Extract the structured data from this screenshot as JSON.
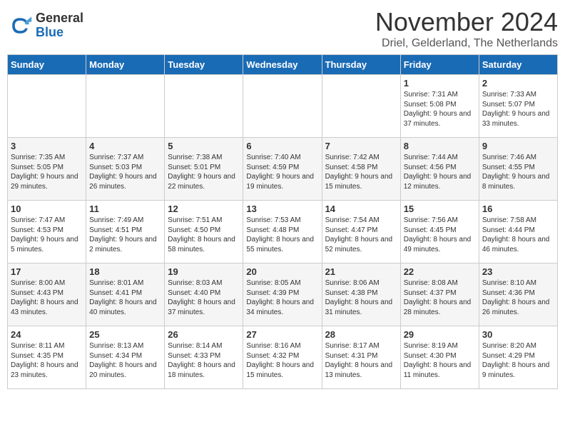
{
  "logo": {
    "general": "General",
    "blue": "Blue"
  },
  "title": "November 2024",
  "location": "Driel, Gelderland, The Netherlands",
  "headers": [
    "Sunday",
    "Monday",
    "Tuesday",
    "Wednesday",
    "Thursday",
    "Friday",
    "Saturday"
  ],
  "weeks": [
    [
      {
        "day": "",
        "info": ""
      },
      {
        "day": "",
        "info": ""
      },
      {
        "day": "",
        "info": ""
      },
      {
        "day": "",
        "info": ""
      },
      {
        "day": "",
        "info": ""
      },
      {
        "day": "1",
        "info": "Sunrise: 7:31 AM\nSunset: 5:08 PM\nDaylight: 9 hours and 37 minutes."
      },
      {
        "day": "2",
        "info": "Sunrise: 7:33 AM\nSunset: 5:07 PM\nDaylight: 9 hours and 33 minutes."
      }
    ],
    [
      {
        "day": "3",
        "info": "Sunrise: 7:35 AM\nSunset: 5:05 PM\nDaylight: 9 hours and 29 minutes."
      },
      {
        "day": "4",
        "info": "Sunrise: 7:37 AM\nSunset: 5:03 PM\nDaylight: 9 hours and 26 minutes."
      },
      {
        "day": "5",
        "info": "Sunrise: 7:38 AM\nSunset: 5:01 PM\nDaylight: 9 hours and 22 minutes."
      },
      {
        "day": "6",
        "info": "Sunrise: 7:40 AM\nSunset: 4:59 PM\nDaylight: 9 hours and 19 minutes."
      },
      {
        "day": "7",
        "info": "Sunrise: 7:42 AM\nSunset: 4:58 PM\nDaylight: 9 hours and 15 minutes."
      },
      {
        "day": "8",
        "info": "Sunrise: 7:44 AM\nSunset: 4:56 PM\nDaylight: 9 hours and 12 minutes."
      },
      {
        "day": "9",
        "info": "Sunrise: 7:46 AM\nSunset: 4:55 PM\nDaylight: 9 hours and 8 minutes."
      }
    ],
    [
      {
        "day": "10",
        "info": "Sunrise: 7:47 AM\nSunset: 4:53 PM\nDaylight: 9 hours and 5 minutes."
      },
      {
        "day": "11",
        "info": "Sunrise: 7:49 AM\nSunset: 4:51 PM\nDaylight: 9 hours and 2 minutes."
      },
      {
        "day": "12",
        "info": "Sunrise: 7:51 AM\nSunset: 4:50 PM\nDaylight: 8 hours and 58 minutes."
      },
      {
        "day": "13",
        "info": "Sunrise: 7:53 AM\nSunset: 4:48 PM\nDaylight: 8 hours and 55 minutes."
      },
      {
        "day": "14",
        "info": "Sunrise: 7:54 AM\nSunset: 4:47 PM\nDaylight: 8 hours and 52 minutes."
      },
      {
        "day": "15",
        "info": "Sunrise: 7:56 AM\nSunset: 4:45 PM\nDaylight: 8 hours and 49 minutes."
      },
      {
        "day": "16",
        "info": "Sunrise: 7:58 AM\nSunset: 4:44 PM\nDaylight: 8 hours and 46 minutes."
      }
    ],
    [
      {
        "day": "17",
        "info": "Sunrise: 8:00 AM\nSunset: 4:43 PM\nDaylight: 8 hours and 43 minutes."
      },
      {
        "day": "18",
        "info": "Sunrise: 8:01 AM\nSunset: 4:41 PM\nDaylight: 8 hours and 40 minutes."
      },
      {
        "day": "19",
        "info": "Sunrise: 8:03 AM\nSunset: 4:40 PM\nDaylight: 8 hours and 37 minutes."
      },
      {
        "day": "20",
        "info": "Sunrise: 8:05 AM\nSunset: 4:39 PM\nDaylight: 8 hours and 34 minutes."
      },
      {
        "day": "21",
        "info": "Sunrise: 8:06 AM\nSunset: 4:38 PM\nDaylight: 8 hours and 31 minutes."
      },
      {
        "day": "22",
        "info": "Sunrise: 8:08 AM\nSunset: 4:37 PM\nDaylight: 8 hours and 28 minutes."
      },
      {
        "day": "23",
        "info": "Sunrise: 8:10 AM\nSunset: 4:36 PM\nDaylight: 8 hours and 26 minutes."
      }
    ],
    [
      {
        "day": "24",
        "info": "Sunrise: 8:11 AM\nSunset: 4:35 PM\nDaylight: 8 hours and 23 minutes."
      },
      {
        "day": "25",
        "info": "Sunrise: 8:13 AM\nSunset: 4:34 PM\nDaylight: 8 hours and 20 minutes."
      },
      {
        "day": "26",
        "info": "Sunrise: 8:14 AM\nSunset: 4:33 PM\nDaylight: 8 hours and 18 minutes."
      },
      {
        "day": "27",
        "info": "Sunrise: 8:16 AM\nSunset: 4:32 PM\nDaylight: 8 hours and 15 minutes."
      },
      {
        "day": "28",
        "info": "Sunrise: 8:17 AM\nSunset: 4:31 PM\nDaylight: 8 hours and 13 minutes."
      },
      {
        "day": "29",
        "info": "Sunrise: 8:19 AM\nSunset: 4:30 PM\nDaylight: 8 hours and 11 minutes."
      },
      {
        "day": "30",
        "info": "Sunrise: 8:20 AM\nSunset: 4:29 PM\nDaylight: 8 hours and 9 minutes."
      }
    ]
  ]
}
